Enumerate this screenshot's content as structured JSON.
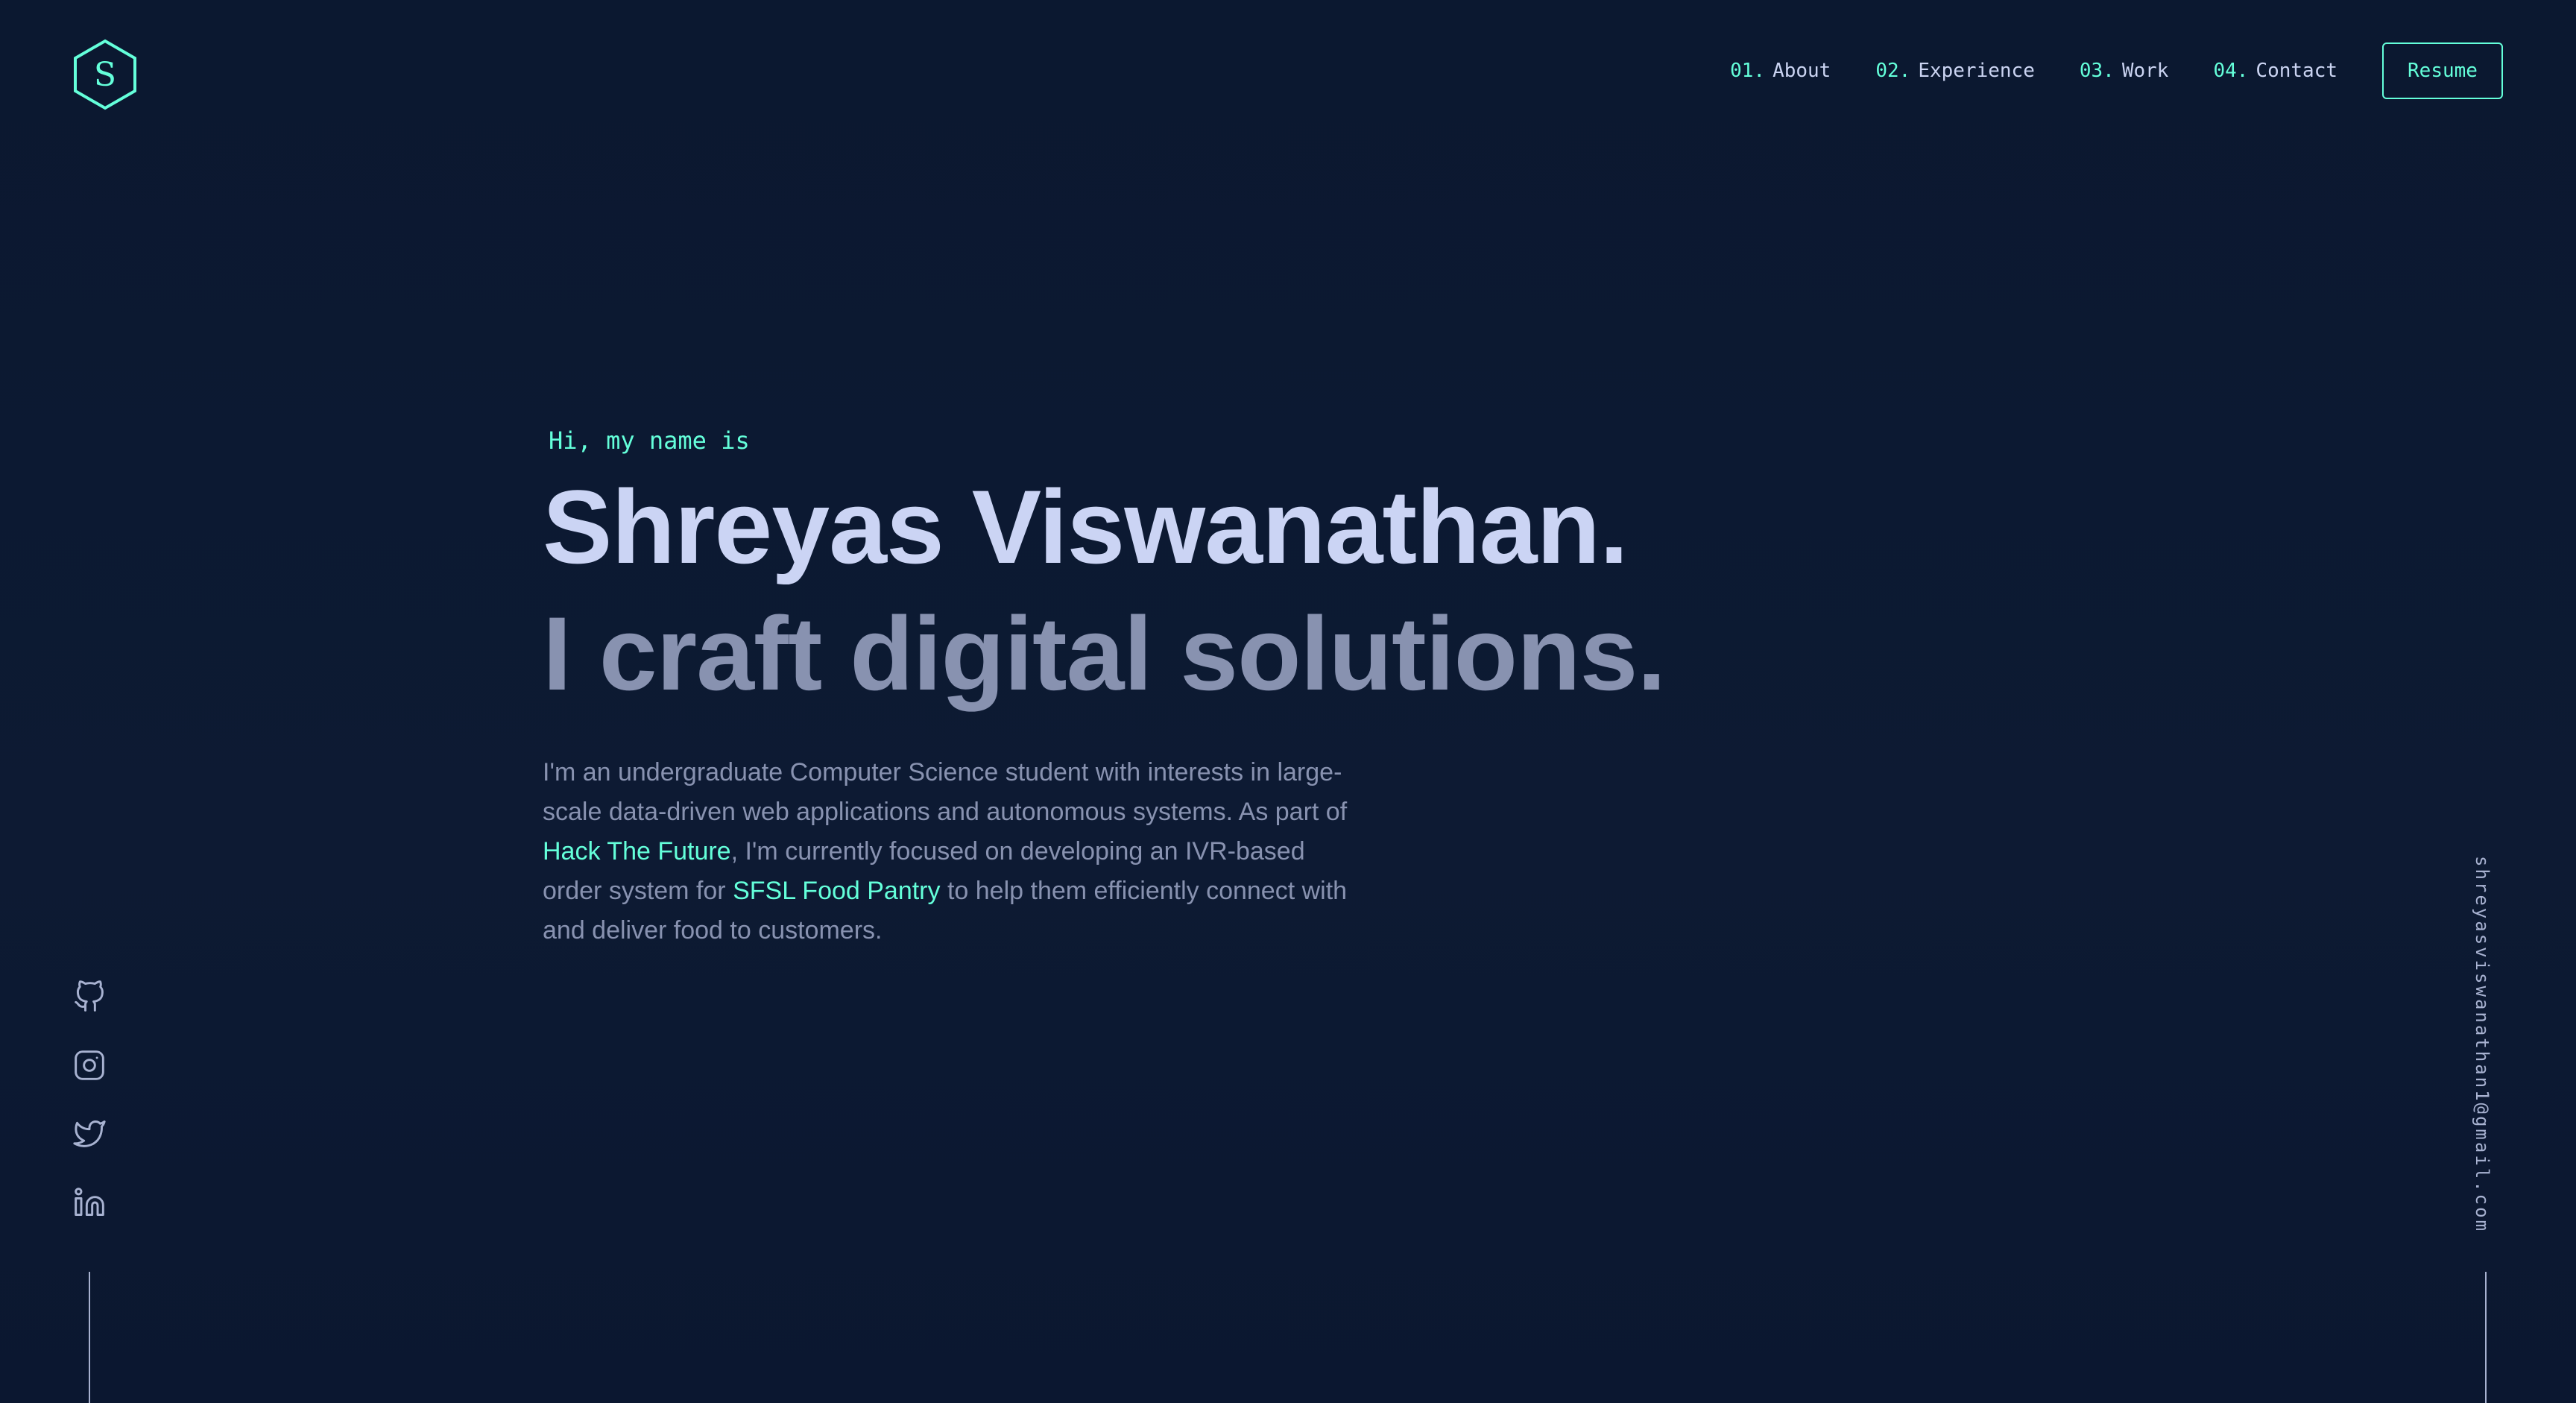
{
  "logo": {
    "letter": "S"
  },
  "nav": {
    "items": [
      {
        "num": "01.",
        "label": "About"
      },
      {
        "num": "02.",
        "label": "Experience"
      },
      {
        "num": "03.",
        "label": "Work"
      },
      {
        "num": "04.",
        "label": "Contact"
      }
    ],
    "resume_label": "Resume"
  },
  "hero": {
    "greeting": "Hi, my name is",
    "name": "Shreyas Viswanathan.",
    "tagline": "I craft digital solutions.",
    "bio": {
      "part1": "I'm an undergraduate Computer Science student with interests in large-scale data-driven web applications and autonomous systems. As part of ",
      "link1": "Hack The Future",
      "part2": ", I'm currently focused on developing an IVR-based order system for ",
      "link2": "SFSL Food Pantry",
      "part3": " to help them efficiently connect with and deliver food to customers."
    }
  },
  "social": {
    "icons": [
      "github-icon",
      "instagram-icon",
      "twitter-icon",
      "linkedin-icon"
    ]
  },
  "email": "shreyasviswanathan1@gmail.com",
  "colors": {
    "background": "#0c182f",
    "accent": "#64ffda",
    "heading": "#cbd4f4",
    "muted": "#8892b0",
    "light": "#a8b2d1"
  }
}
